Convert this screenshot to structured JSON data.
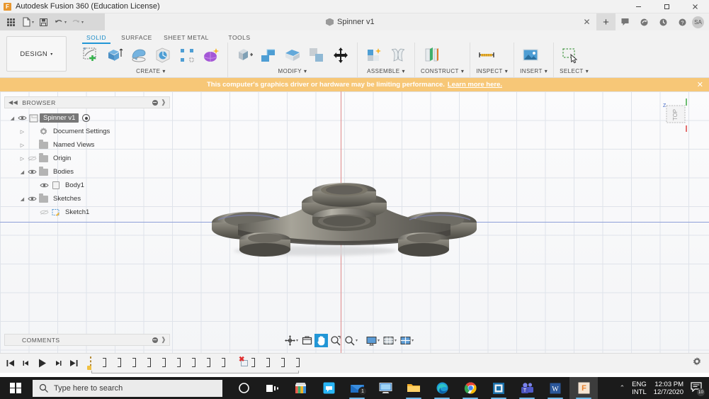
{
  "window": {
    "title": "Autodesk Fusion 360 (Education License)",
    "logo_letter": "F",
    "minimize": "─",
    "maximize": "❐",
    "close": "✕"
  },
  "quick_access": {
    "items": [
      {
        "name": "app-grid-icon",
        "label": ""
      },
      {
        "name": "new-file-icon",
        "label": ""
      },
      {
        "name": "save-icon",
        "label": ""
      },
      {
        "name": "undo-icon",
        "label": ""
      },
      {
        "name": "redo-icon",
        "label": ""
      }
    ]
  },
  "document_tab": {
    "label": "Spinner v1",
    "close": "✕",
    "add": "+",
    "actions": [
      "comment-icon",
      "refresh-icon",
      "job-status-icon",
      "help-icon"
    ],
    "avatar_initials": "SA"
  },
  "ribbon": {
    "workspace": "DESIGN",
    "workspace_caret": "▾",
    "tabs": [
      {
        "label": "SOLID",
        "active": true
      },
      {
        "label": "SURFACE",
        "active": false
      },
      {
        "label": "SHEET METAL",
        "active": false
      },
      {
        "label": "TOOLS",
        "active": false
      }
    ],
    "panels": [
      {
        "label": "CREATE",
        "caret": "▾",
        "tools": [
          "create-sketch-icon",
          "extrude-icon",
          "revolve-icon",
          "sweep-icon",
          "pattern-icon",
          "form-icon"
        ]
      },
      {
        "label": "MODIFY",
        "caret": "▾",
        "tools": [
          "press-pull-icon",
          "fillet-icon",
          "shell-icon",
          "combine-icon",
          "move-copy-icon"
        ]
      },
      {
        "label": "ASSEMBLE",
        "caret": "▾",
        "tools": [
          "new-component-icon",
          "joint-icon"
        ]
      },
      {
        "label": "CONSTRUCT",
        "caret": "▾",
        "tools": [
          "offset-plane-icon"
        ]
      },
      {
        "label": "INSPECT",
        "caret": "▾",
        "tools": [
          "measure-icon"
        ]
      },
      {
        "label": "INSERT",
        "caret": "▾",
        "tools": [
          "insert-image-icon"
        ]
      },
      {
        "label": "SELECT",
        "caret": "▾",
        "tools": [
          "select-window-icon"
        ]
      }
    ]
  },
  "banner": {
    "message": "This computer's graphics driver or hardware may be limiting performance.",
    "link": "Learn more here.",
    "close": "✕",
    "background": "#f7c777"
  },
  "browser": {
    "header": "BROWSER",
    "collapse": "◀◀",
    "tree": [
      {
        "label": "Spinner v1",
        "indent": 0,
        "arrow": "◢",
        "eye": "visible",
        "icon": "component-icon",
        "selected": true,
        "radio": true
      },
      {
        "label": "Document Settings",
        "indent": 1,
        "arrow": "▷",
        "eye": "none",
        "icon": "gear-icon",
        "selected": false,
        "radio": false
      },
      {
        "label": "Named Views",
        "indent": 1,
        "arrow": "▷",
        "eye": "none",
        "icon": "folder-icon",
        "selected": false,
        "radio": false
      },
      {
        "label": "Origin",
        "indent": 1,
        "arrow": "▷",
        "eye": "hidden",
        "icon": "folder-icon",
        "selected": false,
        "radio": false
      },
      {
        "label": "Bodies",
        "indent": 1,
        "arrow": "◢",
        "eye": "visible",
        "icon": "folder-icon",
        "selected": false,
        "radio": false
      },
      {
        "label": "Body1",
        "indent": 2,
        "arrow": "",
        "eye": "visible",
        "icon": "body-icon",
        "selected": false,
        "radio": false
      },
      {
        "label": "Sketches",
        "indent": 1,
        "arrow": "◢",
        "eye": "visible",
        "icon": "folder-icon",
        "selected": false,
        "radio": false
      },
      {
        "label": "Sketch1",
        "indent": 2,
        "arrow": "",
        "eye": "hidden",
        "icon": "sketch-icon",
        "selected": false,
        "radio": false
      }
    ]
  },
  "comments": {
    "header": "COMMENTS"
  },
  "viewcube": {
    "face": "TOP",
    "axis_label": "Z"
  },
  "canvas": {
    "model_name": "fidget-spinner-body",
    "grid": true,
    "horizontal_axis_color": "#8e9fd8",
    "vertical_axis_color": "#e08a8a"
  },
  "navbar": {
    "buttons": [
      {
        "name": "orbit-icon",
        "caret": "▾",
        "active": false
      },
      {
        "name": "look-at-icon",
        "caret": "",
        "active": false
      },
      {
        "name": "pan-icon",
        "caret": "",
        "active": true
      },
      {
        "name": "zoom-fit-icon",
        "caret": "",
        "active": false
      },
      {
        "name": "zoom-icon",
        "caret": "▾",
        "active": false
      },
      {
        "name": "display-settings-icon",
        "caret": "▾",
        "active": false
      },
      {
        "name": "grid-snap-icon",
        "caret": "▾",
        "active": false
      },
      {
        "name": "viewport-layout-icon",
        "caret": "▾",
        "active": false
      }
    ]
  },
  "timeline": {
    "controls": [
      "go-to-beginning",
      "step-back",
      "play",
      "step-forward",
      "go-to-end"
    ],
    "features": [
      {
        "type": "sketch"
      },
      {
        "type": "feature"
      },
      {
        "type": "feature"
      },
      {
        "type": "feature"
      },
      {
        "type": "feature"
      },
      {
        "type": "feature"
      },
      {
        "type": "feature"
      },
      {
        "type": "feature"
      },
      {
        "type": "feature"
      },
      {
        "type": "feature"
      },
      {
        "type": "deleted"
      },
      {
        "type": "feature"
      },
      {
        "type": "feature"
      },
      {
        "type": "feature"
      },
      {
        "type": "feature"
      }
    ],
    "settings_icon": "gear-icon"
  },
  "taskbar": {
    "search_placeholder": "Type here to search",
    "icons": [
      {
        "name": "cortana-icon"
      },
      {
        "name": "task-view-icon"
      },
      {
        "name": "microsoft-store-icon"
      },
      {
        "name": "skype-icon"
      },
      {
        "name": "mail-icon",
        "badge": "1"
      },
      {
        "name": "remote-desktop-icon"
      },
      {
        "name": "file-explorer-icon"
      },
      {
        "name": "edge-icon"
      },
      {
        "name": "chrome-icon"
      },
      {
        "name": "app-icon"
      },
      {
        "name": "teams-icon"
      },
      {
        "name": "word-icon"
      },
      {
        "name": "fusion360-icon"
      }
    ],
    "tray": {
      "chevron": "⌃",
      "language_line1": "ENG",
      "language_line2": "INTL",
      "time": "12:03 PM",
      "date": "12/7/2020",
      "notification_count": "10"
    }
  }
}
